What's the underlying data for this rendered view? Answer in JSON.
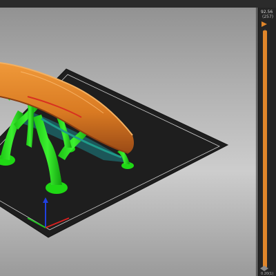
{
  "viewport": {
    "colors": {
      "background_top": "#8f8f8f",
      "background_bottom": "#9a9a9a",
      "bed": "#1e1e1e",
      "bed_outline": "#d8d8d8",
      "model_orange": "#e0862a",
      "model_orange_dark": "#a8541a",
      "support_green": "#22e018",
      "support_green_dark": "#0c8a0a",
      "axis_x": "#d82020",
      "axis_y": "#20c020",
      "axis_z": "#2040e0"
    }
  },
  "layer_slider": {
    "top_value": "92.56",
    "top_index": "(257)",
    "bottom_value": "0.20(1)",
    "accent": "#e0862a"
  }
}
